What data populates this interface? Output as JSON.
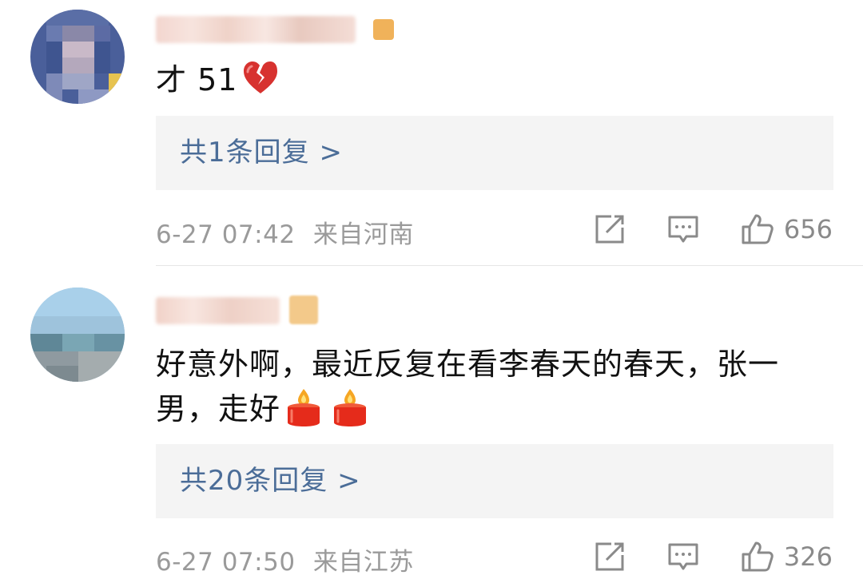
{
  "comments": [
    {
      "text": "才 51",
      "emoji": "broken-heart-icon",
      "reply_label": "共1条回复 >",
      "time": "6-27 07:42",
      "location": "来自河南",
      "likes": "656"
    },
    {
      "text_line1": "好意外啊，最近反复在看李春天的春天，张一",
      "text_line2": "男，走好",
      "emoji": "candle-icon",
      "reply_label": "共20条回复 >",
      "time": "6-27 07:50",
      "location": "来自江苏",
      "likes": "326"
    }
  ],
  "colors": {
    "reply_link": "#4b6d98",
    "meta_text": "#9a9a9a",
    "reply_bg": "#f4f4f4"
  }
}
